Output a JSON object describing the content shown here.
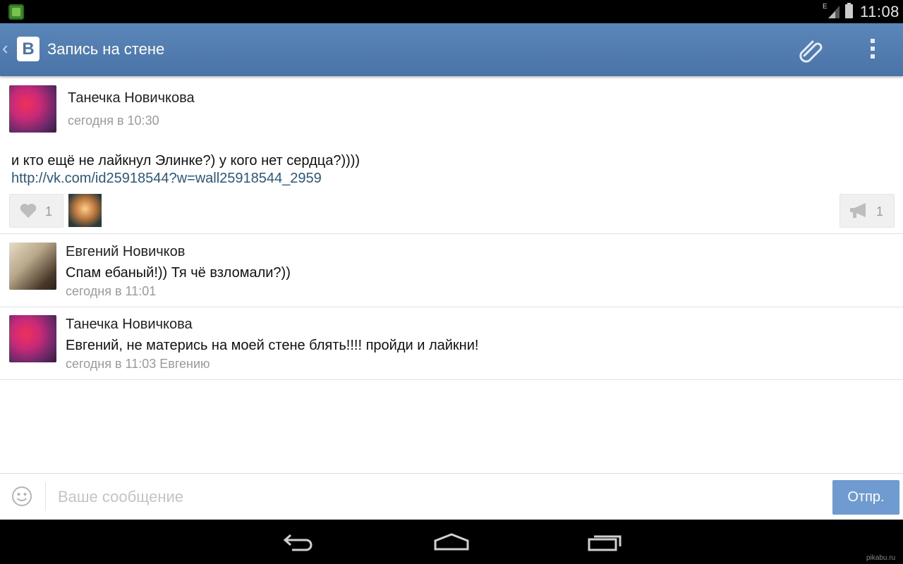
{
  "status_bar": {
    "network_label": "E",
    "time": "11:08"
  },
  "header": {
    "title": "Запись на стене",
    "logo_letter": "B"
  },
  "post": {
    "author": "Танечка Новичкова",
    "time": "сегодня в 10:30",
    "text": "и кто ещё не лайкнул Элинке?) у кого нет сердца?))))",
    "link": "http://vk.com/id25918544?w=wall25918544_2959",
    "likes": "1",
    "shares": "1"
  },
  "comments": [
    {
      "author": "Евгений Новичков",
      "text": "Спам ебаный!)) Тя чё взломали?))",
      "time": "сегодня в 11:01"
    },
    {
      "author": "Танечка Новичкова",
      "text": "Евгений, не матерись на моей стене блять!!!! пройди и лайкни!",
      "time": "сегодня в 11:03 Евгению"
    }
  ],
  "composer": {
    "placeholder": "Ваше сообщение",
    "send_label": "Отпр."
  },
  "watermark": "pikabu.ru",
  "colors": {
    "header": "#4a74a8",
    "link": "#2b587a",
    "send_button": "#6f9bd0"
  },
  "icons": [
    "app-icon",
    "signal-icon",
    "battery-icon",
    "back-icon",
    "vk-logo",
    "paperclip-icon",
    "more-vert-icon",
    "heart-icon",
    "megaphone-icon",
    "smiley-icon",
    "nav-back-icon",
    "nav-home-icon",
    "nav-recents-icon"
  ]
}
